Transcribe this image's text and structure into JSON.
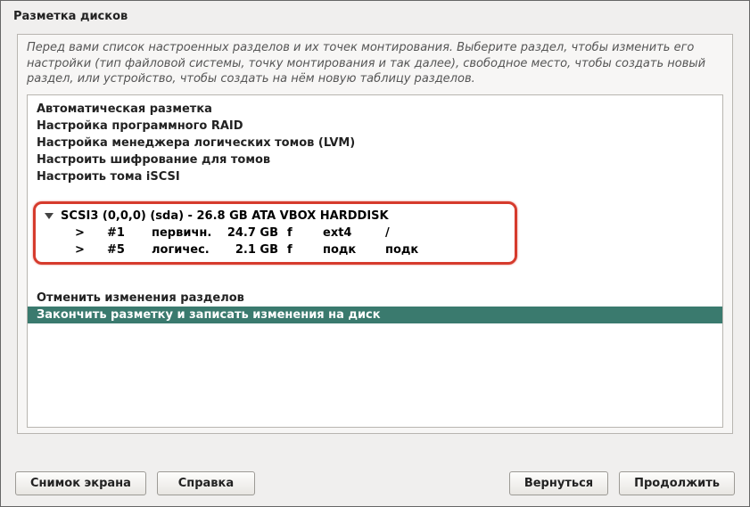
{
  "title": "Разметка дисков",
  "description": "Перед вами список настроенных разделов и их точек монтирования. Выберите раздел, чтобы изменить его настройки (тип файловой системы, точку монтирования и так далее), свободное место, чтобы создать новый раздел, или устройство, чтобы создать на нём новую таблицу разделов.",
  "options": {
    "auto": "Автоматическая разметка",
    "raid": "Настройка программного RAID",
    "lvm": "Настройка менеджера логических томов (LVM)",
    "crypt": "Настроить шифрование для томов",
    "iscsi": "Настроить тома iSCSI"
  },
  "disk": {
    "header": "SCSI3 (0,0,0) (sda) - 26.8 GB ATA VBOX HARDDISK",
    "partitions": [
      {
        "ind": ">",
        "num": "#1",
        "type": "первичн.",
        "size": "24.7 GB",
        "flag": "f",
        "fs": "ext4",
        "mount": "/"
      },
      {
        "ind": ">",
        "num": "#5",
        "type": "логичес.",
        "size": "2.1 GB",
        "flag": "f",
        "fs": "подк",
        "mount": "подк"
      }
    ]
  },
  "actions": {
    "undo": "Отменить изменения разделов",
    "finish": "Закончить разметку и записать изменения на диск"
  },
  "buttons": {
    "screenshot": "Снимок экрана",
    "help": "Справка",
    "back": "Вернуться",
    "continue": "Продолжить"
  }
}
